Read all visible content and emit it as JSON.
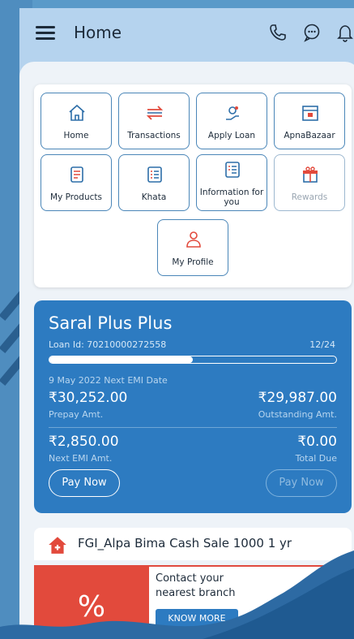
{
  "header": {
    "title": "Home",
    "icons": [
      "menu-icon",
      "phone-icon",
      "chat-icon",
      "bell-icon"
    ]
  },
  "menu": {
    "tiles": [
      {
        "label": "Home",
        "icon": "home-icon"
      },
      {
        "label": "Transactions",
        "icon": "transfer-icon"
      },
      {
        "label": "Apply Loan",
        "icon": "loan-icon"
      },
      {
        "label": "ApnaBazaar",
        "icon": "store-icon"
      },
      {
        "label": "My Products",
        "icon": "products-icon"
      },
      {
        "label": "Khata",
        "icon": "ledger-icon"
      },
      {
        "label": "Information for you",
        "icon": "info-icon"
      },
      {
        "label": "Rewards",
        "icon": "gift-icon"
      },
      {
        "label": "My Profile",
        "icon": "profile-icon"
      }
    ]
  },
  "loan": {
    "title": "Saral Plus Plus",
    "loan_id": "Loan Id: 70210000272558",
    "installments": "12/24",
    "progress": 0.5,
    "next_emi_date": "9 May 2022 Next EMI Date",
    "prepay_amount": "₹30,252.00",
    "prepay_label": "Prepay Amt.",
    "outstanding_amount": "₹29,987.00",
    "outstanding_label": "Outstanding Amt.",
    "next_emi_amount": "₹2,850.00",
    "next_emi_label": "Next EMI Amt.",
    "total_due": "₹0.00",
    "total_due_label": "Total Due",
    "pay_now_label": "Pay Now",
    "pay_now_disabled_label": "Pay Now"
  },
  "insurance": {
    "title": "FGI_Alpa Bima Cash Sale 1000 1 yr"
  },
  "banner": {
    "percent": "%",
    "line1": "Contact your",
    "line2": "nearest branch",
    "button": "KNOW MORE"
  },
  "colors": {
    "primary": "#2d7bc1",
    "accent_red": "#e24a3c",
    "header_bg": "#b5d3ee"
  }
}
